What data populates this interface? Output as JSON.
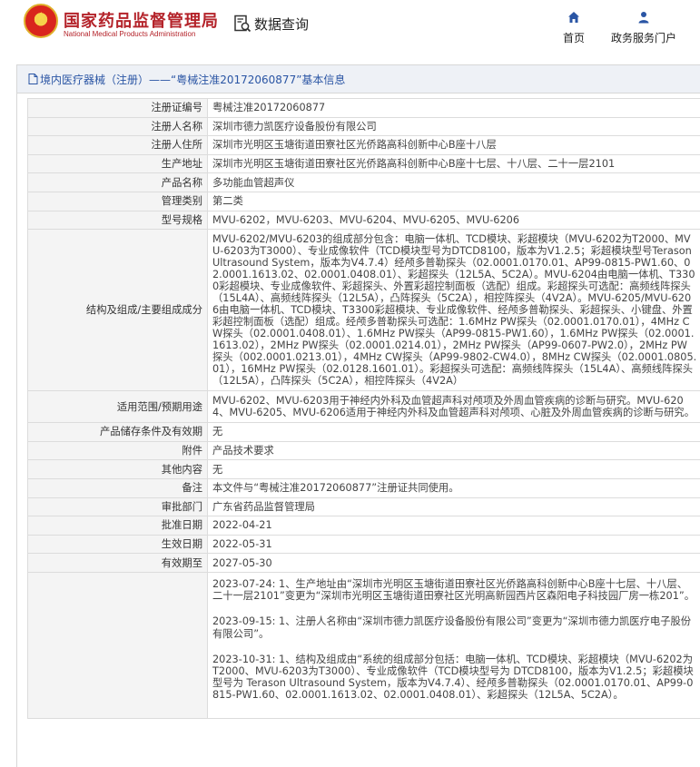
{
  "header": {
    "brand_cn": "国家药品监督管理局",
    "brand_en": "National Medical Products Administration",
    "search_label": "数据查询",
    "nav": [
      {
        "label": "首页",
        "icon": "home-icon"
      },
      {
        "label": "政务服务门户",
        "icon": "user-icon"
      }
    ],
    "brand_color": "#b4232a",
    "link_color": "#2a55a4"
  },
  "breadcrumb": "境内医疗器械（注册）——“粤械注准20172060877”基本信息",
  "rows": [
    {
      "label": "注册证编号",
      "value": "粤械注准20172060877"
    },
    {
      "label": "注册人名称",
      "value": "深圳市德力凯医疗设备股份有限公司"
    },
    {
      "label": "注册人住所",
      "value": "深圳市光明区玉塘街道田寮社区光侨路高科创新中心B座十八层"
    },
    {
      "label": "生产地址",
      "value": "深圳市光明区玉塘街道田寮社区光侨路高科创新中心B座十七层、十八层、二十一层2101"
    },
    {
      "label": "产品名称",
      "value": "多功能血管超声仪"
    },
    {
      "label": "管理类别",
      "value": "第二类"
    },
    {
      "label": "型号规格",
      "value": "MVU-6202，MVU-6203、MVU-6204、MVU-6205、MVU-6206"
    },
    {
      "label": "结构及组成/主要组成成分",
      "value": "MVU-6202/MVU-6203的组成部分包含：电脑一体机、TCD模块、彩超模块（MVU-6202为T2000、MVU-6203为T3000）、专业成像软件（TCD模块型号为DTCD8100，版本为V1.2.5；彩超模块型号Terason Ultrasound System，版本为V4.7.4）经颅多普勒探头（02.0001.0170.01、AP99-0815-PW1.60、02.0001.1613.02、02.0001.0408.01）、彩超探头（12L5A、5C2A）。MVU-6204由电脑一体机、T3300彩超模块、专业成像软件、彩超探头、外置彩超控制面板（选配）组成。彩超探头可选配：高频线阵探头（15L4A）、高频线阵探头（12L5A），凸阵探头（5C2A），相控阵探头（4V2A）。MVU-6205/MVU-6206由电脑一体机、TCD模块、T3300彩超模块、专业成像软件、经颅多普勒探头、彩超探头、小键盘、外置彩超控制面板（选配）组成。经颅多普勒探头可选配：1.6MHz PW探头（02.0001.0170.01），4MHz CW探头（02.0001.0408.01）、1.6MHz PW探头（AP99-0815-PW1.60），1.6MHz PW探头（02.0001.1613.02），2MHz PW探头（02.0001.0214.01），2MHz PW探头（AP99-0607-PW2.0），2MHz PW探头（002.0001.0213.01），4MHz CW探头（AP99-9802-CW4.0），8MHz CW探头（02.0001.0805.01），16MHz PW探头（02.0128.1601.01）。彩超探头可选配：高频线阵探头（15L4A）、高频线阵探头（12L5A），凸阵探头（5C2A），相控阵探头（4V2A）"
    },
    {
      "label": "适用范围/预期用途",
      "value": "MVU-6202、MVU-6203用于神经内外科及血管超声科对颅项及外周血管疾病的诊断与研究。MVU-6204、MVU-6205、MVU-6206适用于神经内外科及血管超声科对颅项、心脏及外周血管疾病的诊断与研究。"
    },
    {
      "label": "产品储存条件及有效期",
      "value": "无"
    },
    {
      "label": "附件",
      "value": "产品技术要求"
    },
    {
      "label": "其他内容",
      "value": "无"
    },
    {
      "label": "备注",
      "value": "本文件与“粤械注准20172060877”注册证共同使用。"
    },
    {
      "label": "审批部门",
      "value": "广东省药品监督管理局"
    },
    {
      "label": "批准日期",
      "value": "2022-04-21"
    },
    {
      "label": "生效日期",
      "value": "2022-05-31"
    },
    {
      "label": "有效期至",
      "value": "2027-05-30"
    }
  ],
  "changes": [
    "2023-07-24: 1、生产地址由“深圳市光明区玉塘街道田寮社区光侨路高科创新中心B座十七层、十八层、二十一层2101”变更为“深圳市光明区玉塘街道田寮社区光明高新园西片区森阳电子科技园厂房一栋201”。",
    "2023-09-15: 1、注册人名称由“深圳市德力凯医疗设备股份有限公司”变更为“深圳市德力凯医疗电子股份有限公司”。",
    "2023-10-31: 1、结构及组成由“系统的组成部分包括：电脑一体机、TCD模块、彩超模块（MVU-6202为T2000、MVU-6203为T3000）、专业成像软件（TCD模块型号为 DTCD8100，版本为V1.2.5；彩超模块型号为 Terason Ultrasound System，版本为V4.7.4）、经颅多普勒探头（02.0001.0170.01、AP99-0815-PW1.60、02.0001.1613.02、02.0001.0408.01）、彩超探头（12L5A、5C2A）。"
  ]
}
